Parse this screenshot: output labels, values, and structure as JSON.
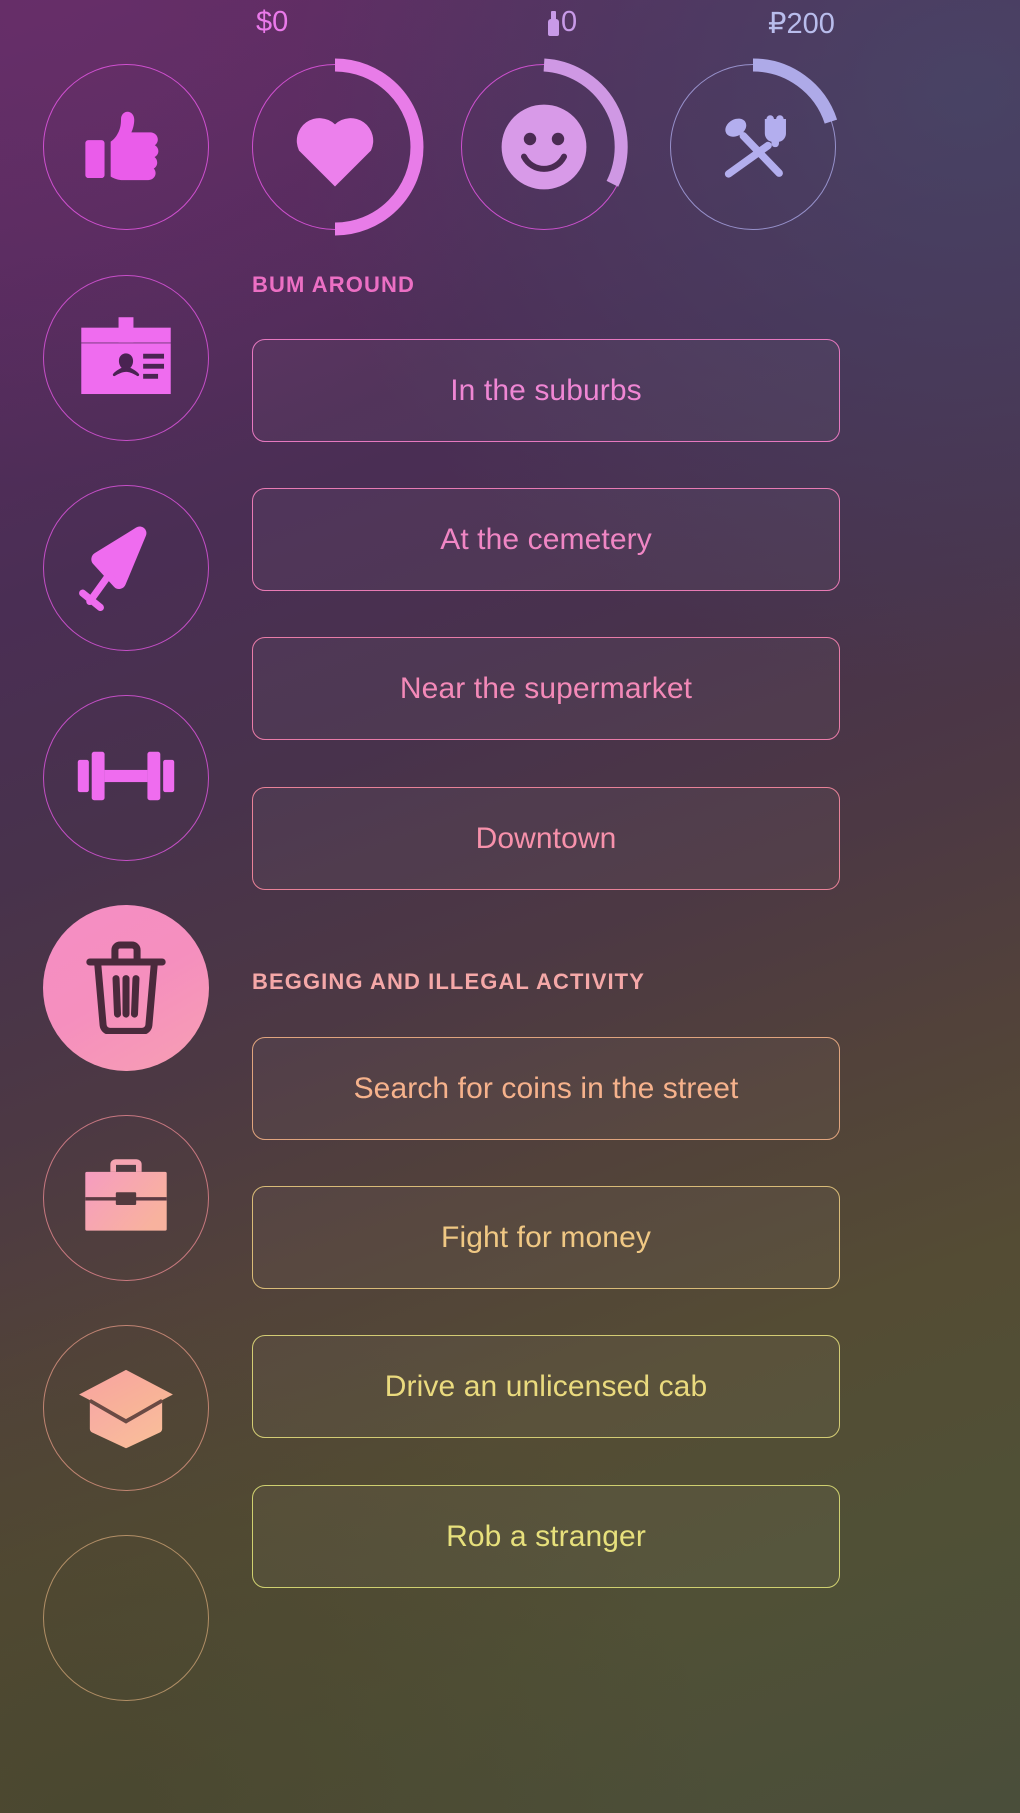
{
  "top_bar": {
    "money": {
      "icon": "dollar-icon",
      "label": "$0",
      "color": "#ea79ea"
    },
    "booze": {
      "icon": "bottle-icon",
      "label": "0",
      "color": "#c89ae8"
    },
    "roubles": {
      "icon": "rouble-icon",
      "label": "₽200",
      "color": "#b9bdec"
    }
  },
  "stats": [
    {
      "name": "approval",
      "icon": "thumbs-up-icon",
      "percent": 0,
      "color": "#e85ce8"
    },
    {
      "name": "health",
      "icon": "heart-icon",
      "percent": 50,
      "color": "#e87ce8"
    },
    {
      "name": "mood",
      "icon": "smiley-icon",
      "percent": 38,
      "color": "#d49ae8"
    },
    {
      "name": "food",
      "icon": "cutlery-icon",
      "percent": 30,
      "color": "#aaa6e6"
    }
  ],
  "sidebar": {
    "items": [
      {
        "name": "id-card",
        "icon": "id-card-icon",
        "active": false
      },
      {
        "name": "drink",
        "icon": "wine-glass-icon",
        "active": false
      },
      {
        "name": "gym",
        "icon": "dumbbell-icon",
        "active": false
      },
      {
        "name": "trash",
        "icon": "trash-can-icon",
        "active": true
      },
      {
        "name": "work",
        "icon": "briefcase-icon",
        "active": false
      },
      {
        "name": "education",
        "icon": "graduation-cap-icon",
        "active": false
      },
      {
        "name": "next",
        "icon": "circle-icon",
        "active": false
      }
    ]
  },
  "sections": [
    {
      "title": "BUM AROUND",
      "title_color": "#ec6fc4",
      "actions": [
        {
          "label": "In the suburbs",
          "text_color": "#ef86d4",
          "border_color": "#e678c0"
        },
        {
          "label": "At the cemetery",
          "text_color": "#f086c4",
          "border_color": "#e87ab4"
        },
        {
          "label": "Near the supermarket",
          "text_color": "#f389b8",
          "border_color": "#e87ca8"
        },
        {
          "label": "Downtown",
          "text_color": "#f791ab",
          "border_color": "#e88298"
        }
      ]
    },
    {
      "title": "BEGGING AND ILLEGAL ACTIVITY",
      "title_color": "#f5a8a8",
      "actions": [
        {
          "label": "Search for coins in the street",
          "text_color": "#f6b28c",
          "border_color": "#e0a47e"
        },
        {
          "label": "Fight for money",
          "text_color": "#f0c884",
          "border_color": "#d9bb78"
        },
        {
          "label": "Drive an unlicensed cab",
          "text_color": "#eada7e",
          "border_color": "#d3cc74"
        },
        {
          "label": "Rob a stranger",
          "text_color": "#e7e07c",
          "border_color": "#cfd070"
        }
      ]
    }
  ]
}
